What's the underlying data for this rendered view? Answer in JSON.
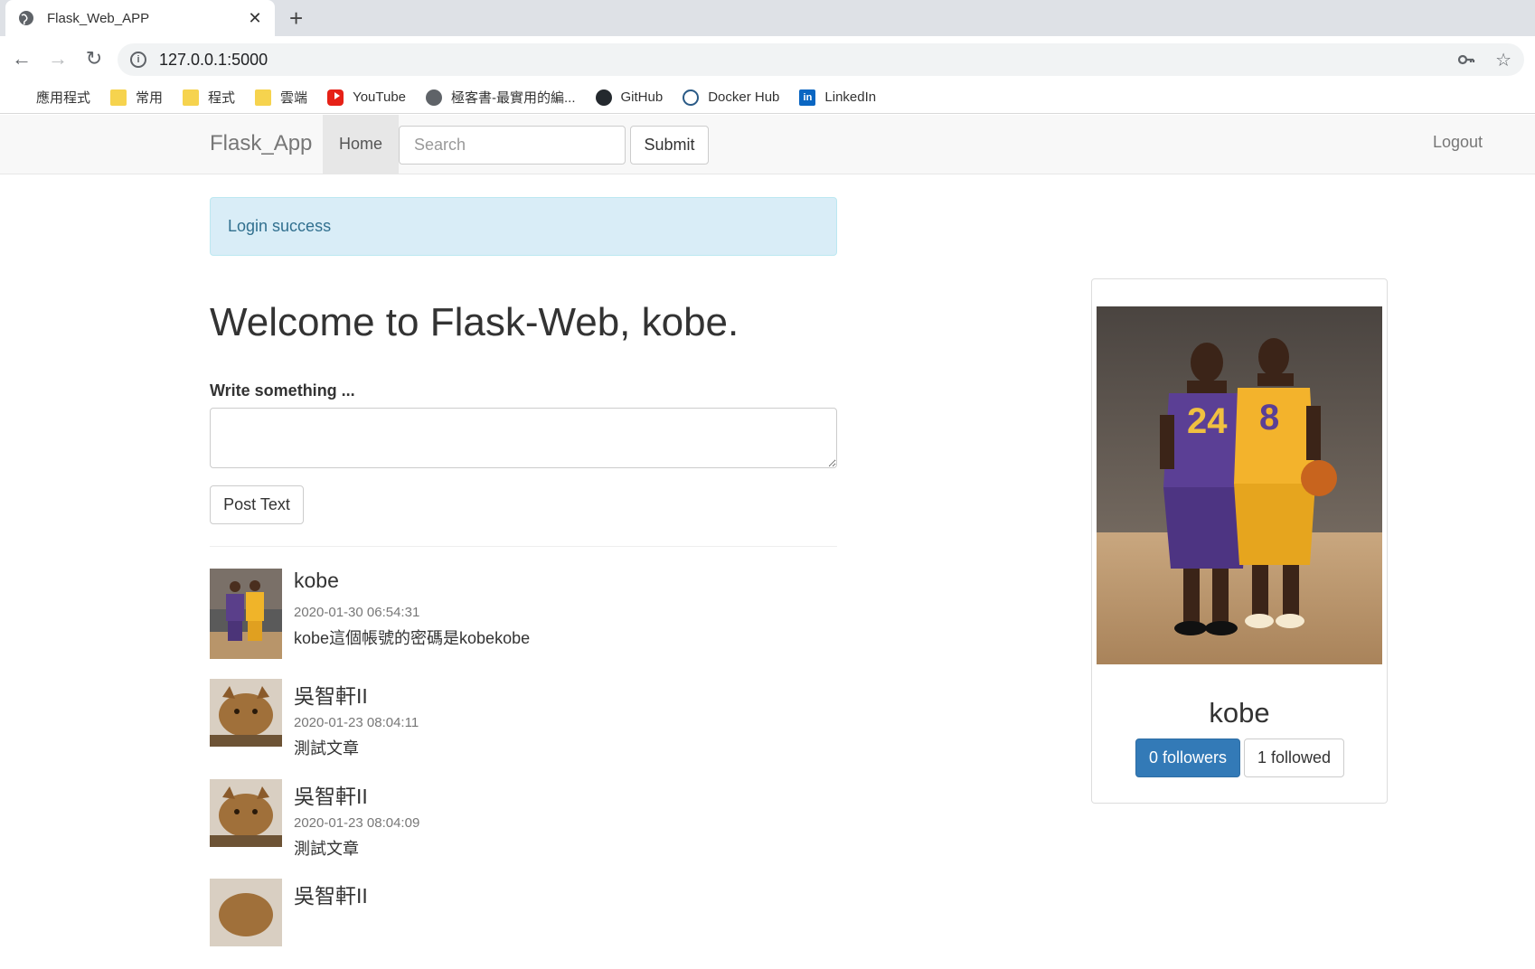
{
  "browser": {
    "tab_title": "Flask_Web_APP",
    "url": "127.0.0.1:5000",
    "bookmarks": [
      {
        "label": "應用程式",
        "icon": "apps-grid-icon"
      },
      {
        "label": "常用",
        "icon": "folder-icon"
      },
      {
        "label": "程式",
        "icon": "folder-icon"
      },
      {
        "label": "雲端",
        "icon": "folder-icon"
      },
      {
        "label": "YouTube",
        "icon": "youtube-icon"
      },
      {
        "label": "極客書-最實用的編...",
        "icon": "globe-icon"
      },
      {
        "label": "GitHub",
        "icon": "github-icon"
      },
      {
        "label": "Docker Hub",
        "icon": "docker-icon"
      },
      {
        "label": "LinkedIn",
        "icon": "linkedin-icon"
      }
    ]
  },
  "navbar": {
    "brand": "Flask_App",
    "home": "Home",
    "search_placeholder": "Search",
    "submit": "Submit",
    "logout": "Logout"
  },
  "alert": "Login success",
  "main": {
    "welcome": "Welcome to Flask-Web, kobe.",
    "write_label": "Write something ...",
    "post_button": "Post Text"
  },
  "posts": [
    {
      "author": "kobe",
      "time": "2020-01-30 06:54:31",
      "body": "kobe這個帳號的密碼是kobekobe",
      "avatar": "basketball"
    },
    {
      "author": "吳智軒II",
      "time": "2020-01-23 08:04:11",
      "body": "測試文章",
      "avatar": "cat"
    },
    {
      "author": "吳智軒II",
      "time": "2020-01-23 08:04:09",
      "body": "測試文章",
      "avatar": "cat"
    },
    {
      "author": "吳智軒II",
      "time": "",
      "body": "",
      "avatar": "cat"
    }
  ],
  "profile": {
    "name": "kobe",
    "followers": "0 followers",
    "followed": "1 followed"
  },
  "colors": {
    "primary": "#337ab7",
    "alert_bg": "#d9edf7",
    "alert_text": "#31708f",
    "navbar_bg": "#f8f8f8"
  }
}
